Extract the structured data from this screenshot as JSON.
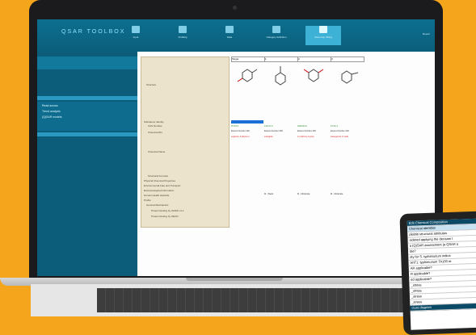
{
  "app": {
    "logo": "QSAR TOOLBOX"
  },
  "tabs": [
    {
      "label": "Input",
      "active": false
    },
    {
      "label": "Profiling",
      "active": false
    },
    {
      "label": "Data",
      "active": false
    },
    {
      "label": "Category definition",
      "active": false
    },
    {
      "label": "Data Gap Filling",
      "active": true
    }
  ],
  "topright": {
    "text": "Report"
  },
  "leftpane": {
    "items": [
      "Read across",
      "Trend analysis",
      "(Q)SAR models"
    ]
  },
  "table": {
    "header": [
      "Target",
      "1",
      "2",
      "3"
    ],
    "tree": [
      "Structure",
      "Substance Identity",
      "CAS Number",
      "Chemical IDs",
      "Chemical Name",
      "Structural Formula",
      "Physical Chemical Properties",
      "Environmental Fate and Transport",
      "Ecotoxicological Information",
      "Human Health Hazards",
      "Profile",
      "General Mechanistic",
      "Protein binding by OASIS v1.1",
      "Protein binding by OECD"
    ],
    "cas": [
      "97-53-0",
      "140-67-0",
      "4602-84-0",
      "97-54-1"
    ],
    "ids": [
      "Einecs Number 202",
      "Einecs Number 205",
      "Einecs Number 225",
      "Einecs Number 202"
    ],
    "names": [
      "eugenol; 4-allyl-2-m",
      "estragole",
      "2-methoxy-4-prop",
      "isoeugenol; 2-meth"
    ],
    "binding": [
      "",
      "M - Weak",
      "M - Moderate",
      "M - Moderate"
    ]
  },
  "tablet": {
    "rows": [
      {
        "text": "Edit   Chemical Composition",
        "style": "hd"
      },
      {
        "text": "Chemical identifier",
        "style": "blue"
      },
      {
        "text": "pliable structural attributes",
        "style": ""
      },
      {
        "text": "sidered applying the decision t",
        "style": ""
      },
      {
        "text": "a (Q)SAR assessment (a QSAR o",
        "style": ""
      },
      {
        "text": "ble?",
        "style": ""
      },
      {
        "text": "ely for S. typhimurium indica",
        "style": ""
      },
      {
        "text": "lxhT1: typhimurium TA100 re",
        "style": ""
      },
      {
        "text": "AR applicable?",
        "style": ""
      },
      {
        "text": "R applicable?",
        "style": ""
      },
      {
        "text": "ed applicable?",
        "style": ""
      },
      {
        "text": "_stress",
        "style": ""
      },
      {
        "text": "_stress",
        "style": ""
      },
      {
        "text": "_stress",
        "style": ""
      },
      {
        "text": "_stress",
        "style": ""
      },
      {
        "text": "cture diagram",
        "style": "hd"
      }
    ]
  }
}
